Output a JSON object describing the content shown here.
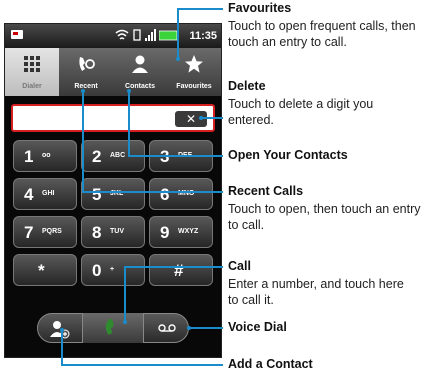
{
  "status": {
    "time": "11:35"
  },
  "tabs": [
    "Dialer",
    "Recent",
    "Contacts",
    "Favourites"
  ],
  "keys": [
    {
      "digit": "1",
      "letters": "oo"
    },
    {
      "digit": "2",
      "letters": "ABC"
    },
    {
      "digit": "3",
      "letters": "DEF"
    },
    {
      "digit": "4",
      "letters": "GHI"
    },
    {
      "digit": "5",
      "letters": "JKL"
    },
    {
      "digit": "6",
      "letters": "MNO"
    },
    {
      "digit": "7",
      "letters": "PQRS"
    },
    {
      "digit": "8",
      "letters": "TUV"
    },
    {
      "digit": "9",
      "letters": "WXYZ"
    },
    {
      "digit": "*",
      "letters": ""
    },
    {
      "digit": "0",
      "letters": "+"
    },
    {
      "digit": "#",
      "letters": ""
    }
  ],
  "callouts": {
    "favourites": {
      "title": "Favourites",
      "text": "Touch to open frequent calls, then touch an entry to call."
    },
    "delete": {
      "title": "Delete",
      "text": "Touch to delete a digit you entered."
    },
    "contacts": {
      "title": "Open Your Contacts"
    },
    "recent": {
      "title": "Recent Calls",
      "text": "Touch to open, then touch an entry to call."
    },
    "call": {
      "title": "Call",
      "text": "Enter a number, and touch here to call it."
    },
    "voice": {
      "title": "Voice Dial"
    },
    "add": {
      "title": "Add a Contact"
    }
  },
  "colors": {
    "accent": "#1a8ccb",
    "entry_border": "#d42020",
    "call_green": "#2e8b2e"
  }
}
